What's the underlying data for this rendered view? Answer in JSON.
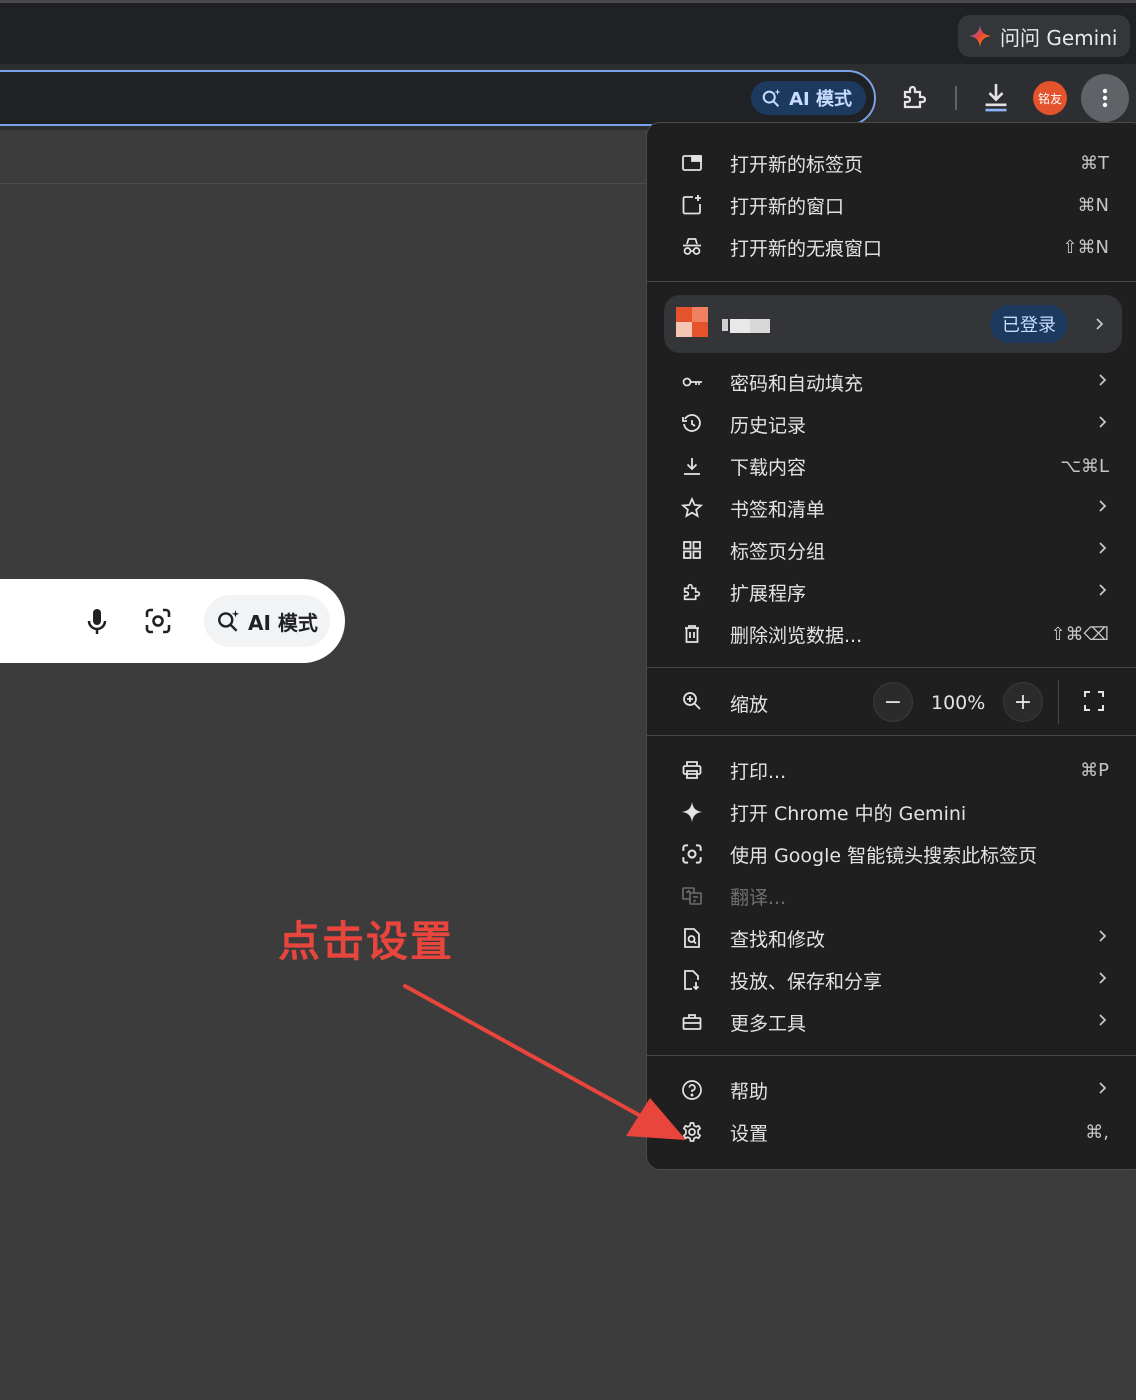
{
  "tabstrip": {
    "gemini_label": "问问 Gemini"
  },
  "toolbar": {
    "ai_mode_label": "AI 模式",
    "avatar_text": "铭友"
  },
  "search_box": {
    "ai_mode_label": "AI 模式"
  },
  "annotation": {
    "text": "点击设置",
    "color": "#e8453c"
  },
  "menu": {
    "group1": [
      {
        "label": "打开新的标签页",
        "shortcut": "⌘T",
        "icon": "new-tab-icon"
      },
      {
        "label": "打开新的窗口",
        "shortcut": "⌘N",
        "icon": "new-window-icon"
      },
      {
        "label": "打开新的无痕窗口",
        "shortcut": "⇧⌘N",
        "icon": "incognito-icon"
      }
    ],
    "profile": {
      "status": "已登录"
    },
    "group2": [
      {
        "label": "密码和自动填充",
        "icon": "key-icon"
      },
      {
        "label": "历史记录",
        "icon": "history-icon"
      },
      {
        "label": "下载内容",
        "shortcut": "⌥⌘L",
        "icon": "download-icon"
      },
      {
        "label": "书签和清单",
        "icon": "star-icon"
      },
      {
        "label": "标签页分组",
        "icon": "tab-groups-icon"
      },
      {
        "label": "扩展程序",
        "icon": "extension-icon"
      },
      {
        "label": "删除浏览数据...",
        "shortcut": "⇧⌘⌫",
        "icon": "trash-icon"
      }
    ],
    "zoom": {
      "label": "缩放",
      "value": "100%",
      "minus": "−",
      "plus": "+"
    },
    "group3": [
      {
        "label": "打印...",
        "shortcut": "⌘P",
        "icon": "print-icon"
      },
      {
        "label": "打开 Chrome 中的 Gemini",
        "icon": "sparkle-icon"
      },
      {
        "label": "使用 Google 智能镜头搜索此标签页",
        "icon": "lens-icon"
      },
      {
        "label": "翻译...",
        "icon": "translate-icon",
        "disabled": true
      },
      {
        "label": "查找和修改",
        "icon": "find-icon"
      },
      {
        "label": "投放、保存和分享",
        "icon": "cast-save-share-icon"
      },
      {
        "label": "更多工具",
        "icon": "toolbox-icon"
      }
    ],
    "group4": [
      {
        "label": "帮助",
        "icon": "help-icon"
      },
      {
        "label": "设置",
        "shortcut": "⌘,",
        "icon": "settings-gear-icon"
      }
    ]
  }
}
